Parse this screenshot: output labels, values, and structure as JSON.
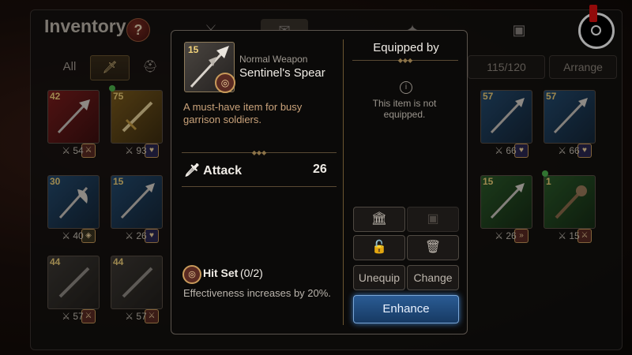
{
  "header": {
    "title": "Inventory",
    "help_glyph": "?",
    "slot_count": "115/120",
    "arrange_label": "Arrange"
  },
  "filters": {
    "all_label": "All"
  },
  "grid_left": [
    {
      "level": "42",
      "stat": "54",
      "color": "red",
      "new": false
    },
    {
      "level": "75",
      "stat": "93",
      "color": "gold",
      "new": true
    },
    {
      "level": "30",
      "stat": "40",
      "color": "blue",
      "new": false
    },
    {
      "level": "15",
      "stat": "26",
      "color": "blue",
      "new": false
    },
    {
      "level": "44",
      "stat": "57",
      "color": "gray",
      "new": false
    },
    {
      "level": "44",
      "stat": "57",
      "color": "gray",
      "new": false
    }
  ],
  "grid_right": [
    {
      "level": "57",
      "stat": "66",
      "color": "blue",
      "new": false
    },
    {
      "level": "57",
      "stat": "66",
      "color": "blue",
      "new": false
    },
    {
      "level": "15",
      "stat": "26",
      "color": "green",
      "new": false
    },
    {
      "level": "1",
      "stat": "15",
      "color": "green",
      "new": true
    }
  ],
  "detail": {
    "level": "15",
    "type": "Normal Weapon",
    "name": "Sentinel's Spear",
    "description": "A must-have item for busy garrison soldiers.",
    "attack_label": "Attack",
    "attack_value": "26",
    "set_name": "Hit Set",
    "set_count": "(0/2)",
    "set_description": "Effectiveness increases by 20%."
  },
  "equipped": {
    "title": "Equipped by",
    "note": "This item is not equipped.",
    "info_glyph": "i"
  },
  "buttons": {
    "unequip": "Unequip",
    "change": "Change",
    "enhance": "Enhance"
  },
  "colors": {
    "enhance_blue": "#2a5b94",
    "accent_gold": "#8c7348",
    "record_red": "#e01010"
  }
}
